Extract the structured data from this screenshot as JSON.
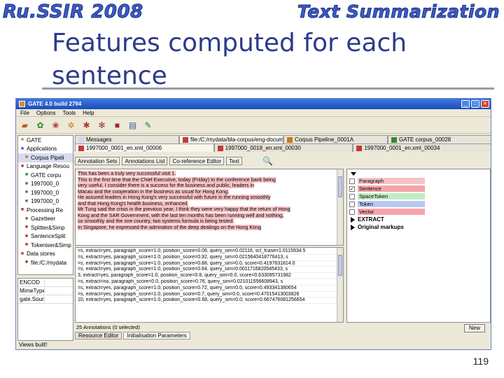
{
  "slide": {
    "banner_left": "Ru.SSIR 2008",
    "banner_right": "Text Summarization",
    "title_line1": "Features computed for each",
    "title_line2": "sentence",
    "page_number": "119"
  },
  "gate": {
    "window_title": "GATE 4.0 build 2794",
    "menu": [
      "File",
      "Options",
      "Tools",
      "Help"
    ],
    "tree": [
      {
        "label": "GATE",
        "icon": "gate-icon",
        "level": 0
      },
      {
        "label": "Applications",
        "icon": "applications-icon",
        "level": 0
      },
      {
        "label": "Corpus Pipeli",
        "icon": "pipeline-icon",
        "level": 1
      },
      {
        "label": "Language Resou",
        "icon": "folder-icon",
        "level": 0
      },
      {
        "label": "GATE corpu",
        "icon": "corpus-icon",
        "level": 1
      },
      {
        "label": "1997000_0",
        "icon": "document-icon",
        "level": 1
      },
      {
        "label": "1997000_0",
        "icon": "document-icon",
        "level": 1
      },
      {
        "label": "1997000_0",
        "icon": "document-icon",
        "level": 1
      },
      {
        "label": "Processing Re",
        "icon": "processing-icon",
        "level": 0
      },
      {
        "label": "Gazetteer",
        "icon": "gazetteer-icon",
        "level": 1
      },
      {
        "label": "Splitter&Simp",
        "icon": "splitter-icon",
        "level": 1
      },
      {
        "label": "SentenceSplit",
        "icon": "splitter-icon",
        "level": 1
      },
      {
        "label": "Tokeniser&Simp",
        "icon": "tokeniser-icon",
        "level": 1
      },
      {
        "label": "Data stores",
        "icon": "datastore-icon",
        "level": 0
      },
      {
        "label": "file:/C:/mydata",
        "icon": "datastore-file-icon",
        "level": 1
      }
    ],
    "props": [
      {
        "k": "ENCOD",
        "v": ""
      },
      {
        "k": "MimeType",
        "v": ""
      },
      {
        "k": "gate.SourceURL",
        "v": ""
      }
    ],
    "status": "Views built!",
    "doc_tabs": [
      {
        "label": "Messages",
        "icon": "messages-icon"
      },
      {
        "label": "file:/C:/mydata/bla-corpus/eng-documents/esswr/",
        "icon": "document-tab-icon"
      },
      {
        "label": "Corpus Pipeline_0001A",
        "icon": "pipeline-tab-icon"
      },
      {
        "label": "GATE corpus_00028",
        "icon": "corpus-tab-icon"
      }
    ],
    "doc_tabs2": [
      {
        "label": "1997000_0001_en.xml_00006",
        "icon": "document-tab-icon",
        "active": true
      },
      {
        "label": "1997000_0018_en.xml_00030",
        "icon": "document-tab-icon",
        "active": false
      },
      {
        "label": "1997000_0001_en.xml_00034",
        "icon": "document-tab-icon",
        "active": false
      }
    ],
    "view_buttons": [
      "Annotation Sets",
      "Annotations List",
      "Co-reference Editor",
      "Text"
    ],
    "text_lines": [
      "This has been a truly very successful visit 1.",
      "This is the first time that the Chief Executive, today (Friday) to the conference bank being",
      "very useful, I consider there is a success for the business and public, leaders in",
      "Macau and the cooperation in the business as usual for Hong Kong.",
      "He assured leaders in Hong Kong's very successful with future in the running smoothly",
      "and that Hong Kong's health business, enhanced.",
      "Mr Tung said the crisis in the previous year, I think they were very happy that the return of Hong",
      "Kong and the SAR Government, with the last ten months has been running well and nothing,",
      "so smoothly and the one country, two systems formula is being tested.",
      "In Singapore, he expressed the admiration of the deep dealings on the Hong Kong"
    ],
    "text_highlight_rows": [
      0,
      1,
      2,
      3,
      4,
      5,
      6,
      7,
      8,
      9
    ],
    "annotation_rows": [
      "=s, extract=yes, paragraph_score=1.0, position_score=0.06, query_sim=0.02116, scl_fcase=1.0115934.5",
      "=s, extract=yes, paragraph_score=1.0, position_score=0.92, query_sim=0.0215640418776413, s",
      "=s, extract=yes, paragraph_score=1.0, position_score=0.88, query_sim=0.0, score=0.4197631814.0",
      "=s, extract=yes, paragraph_score=1.0, position_score=0.84, query_sim=0.0011716820545433, s",
      "3, extract=yes, paragraph_score=1.0, position_score=0.8, query_sim=0.0, score=0.633095731982",
      "=s, extract=no, paragraph_score=0.0, position_score=0.76, query_sim=0.021011556608943, s",
      "=s, extract=yes, paragraph_score=1.0, position_score=0.72, query_sim=0.0, score=0.493341380654",
      "=s, extract=yes, paragraph_score=1.0, position_score=0.7, query_sim=0.0, score=0.47015413003826",
      "10, extract=yes, paragraph_score=1.0, position_score=0.68, query_sim=0.0, score=0.667476081256654"
    ],
    "annotation_count": "25 Annotations (0 selected)",
    "bottom_tabs": [
      "Resource Editor",
      "Initialisation Parameters"
    ],
    "annotation_sets": [
      {
        "label": "Paragraph",
        "color": "#f7c3c6",
        "checked": false
      },
      {
        "label": "Sentence",
        "color": "#f7a3aa",
        "checked": true
      },
      {
        "label": "SpaceToken",
        "color": "#bfeec0",
        "checked": false
      },
      {
        "label": "Token",
        "color": "#b9c8f0",
        "checked": false
      },
      {
        "label": "Vector",
        "color": "#f7a3aa",
        "checked": false
      }
    ],
    "set_groups": [
      "EXTRACT",
      "Original markups"
    ],
    "new_button": "New"
  }
}
